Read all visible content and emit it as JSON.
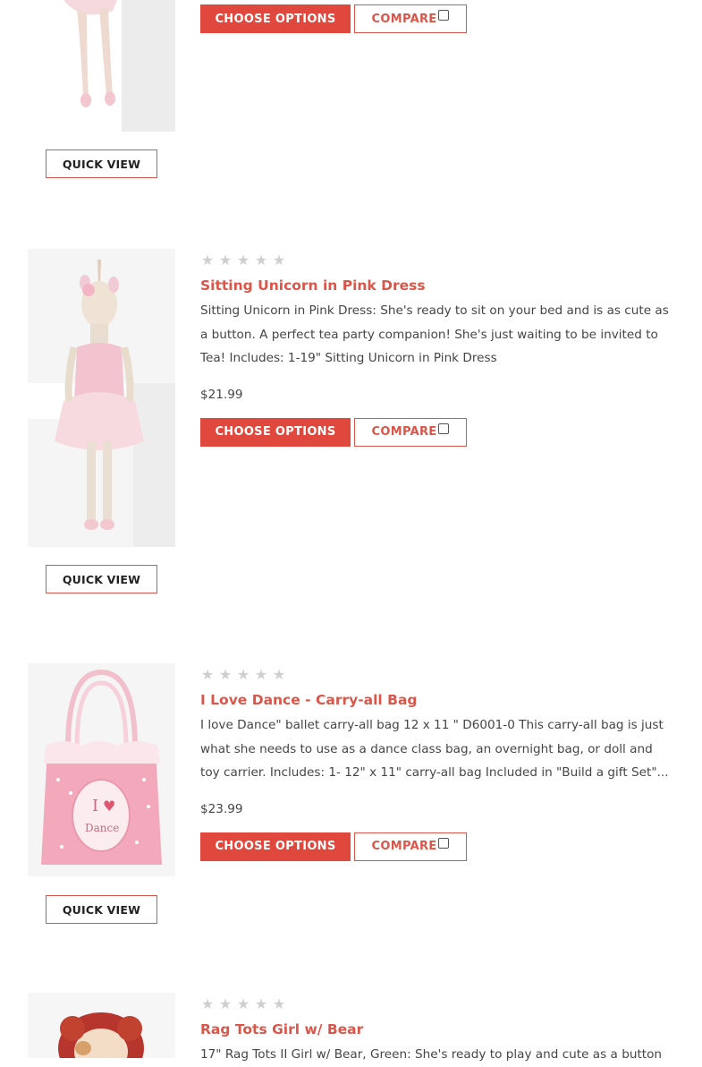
{
  "products": [
    {
      "title": "",
      "description": "",
      "price": "",
      "choose_label": "CHOOSE OPTIONS",
      "compare_label": "COMPARE",
      "quick_view_label": "QUICK VIEW",
      "rating": 0
    },
    {
      "title": "Sitting Unicorn in Pink Dress",
      "description_lines": [
        "Sitting Unicorn in Pink Dress: She's ready to sit on your bed and is as cute as",
        "a button. A perfect tea party companion! She's just waiting to be invited to",
        "Tea! Includes: 1-19\" Sitting Unicorn in Pink Dress"
      ],
      "price": "$21.99",
      "choose_label": "CHOOSE OPTIONS",
      "compare_label": "COMPARE",
      "quick_view_label": "QUICK VIEW",
      "rating": 0
    },
    {
      "title": "I Love Dance - Carry-all Bag",
      "description_lines": [
        " I love Dance\" ballet carry-all bag 12 x 11 \" D6001-0 This carry-all bag is just",
        "what she needs to use as a dance class bag, an overnight bag, or doll and",
        "toy carrier. Includes: 1- 12\" x 11\" carry-all bag   Included in \"Build a gift Set\"..."
      ],
      "price": "$23.99",
      "choose_label": "CHOOSE OPTIONS",
      "compare_label": "COMPARE",
      "quick_view_label": "QUICK VIEW",
      "rating": 0
    },
    {
      "title": "Rag Tots Girl w/ Bear",
      "description_lines": [
        " 17\" Rag Tots II Girl w/ Bear, Green: She's ready to play and cute as a button"
      ],
      "rating": 0
    }
  ],
  "colors": {
    "accent": "#d9574a",
    "button_fill": "#e0483e",
    "star_empty": "#cfcfcf",
    "text": "#454545"
  },
  "icons": {
    "star": "star-icon",
    "compare_checkbox": "checkbox-icon"
  }
}
